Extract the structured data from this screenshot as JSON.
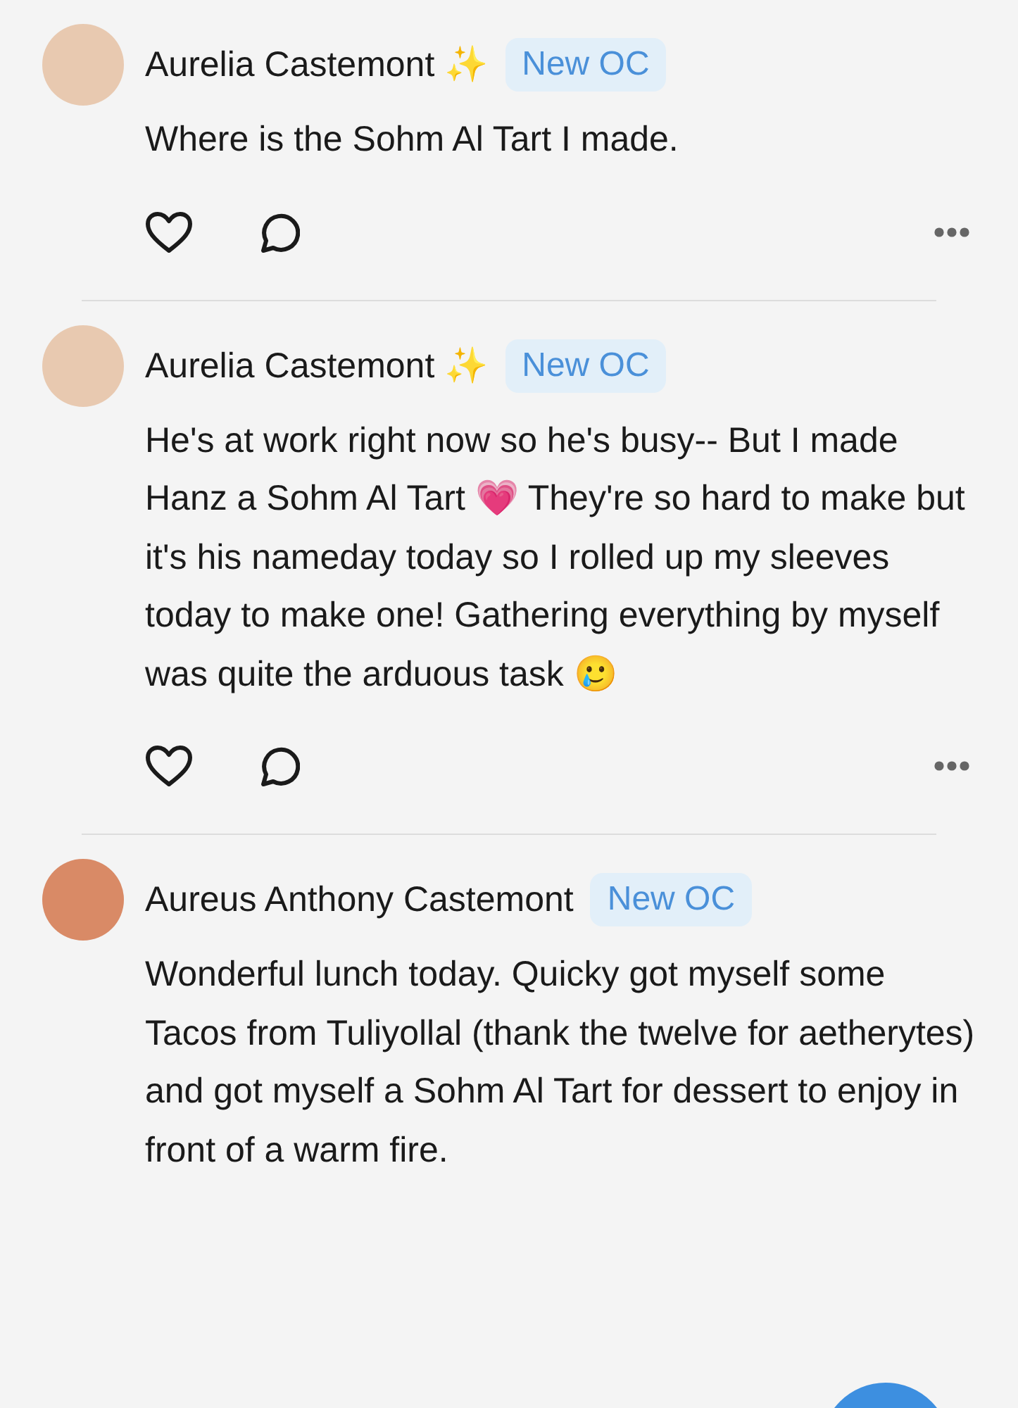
{
  "posts": [
    {
      "author": "Aurelia Castemont ✨",
      "badge": "New OC",
      "text": "Where is the Sohm Al Tart I made."
    },
    {
      "author": "Aurelia Castemont ✨",
      "badge": "New OC",
      "text": "He's at work right now so he's busy-- But I made Hanz a Sohm Al Tart 💗 They're so hard to make but it's his nameday today so I rolled up my sleeves today to make one! Gathering everything by myself was quite the arduous task 🥲"
    },
    {
      "author": "Aureus Anthony Castemont",
      "badge": "New OC",
      "text": "Wonderful lunch today. Quicky got myself some Tacos from Tuliyollal (thank the twelve for aetherytes) and got myself a Sohm Al Tart for dessert to enjoy in front of a warm fire."
    }
  ]
}
